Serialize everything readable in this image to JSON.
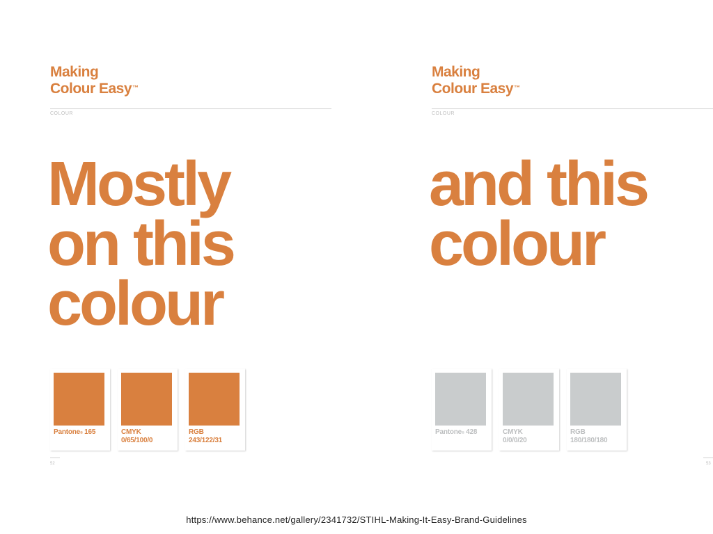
{
  "colors": {
    "orange": "#D9803F",
    "grey": "#C9CCCD",
    "grey_text": "#BDBFC0",
    "rule": "#CFCFCF"
  },
  "left_page": {
    "brand": {
      "line1": "Making",
      "line2": "Colour Easy",
      "trademark": "™"
    },
    "section_label": "COLOUR",
    "headline": [
      "Mostly",
      "on this",
      "colour"
    ],
    "swatches": [
      {
        "label": "Pantone",
        "reg": "®",
        "value": "165",
        "line2": ""
      },
      {
        "label": "CMYK",
        "reg": "",
        "value": "",
        "line2": "0/65/100/0"
      },
      {
        "label": "RGB",
        "reg": "",
        "value": "",
        "line2": "243/122/31"
      }
    ],
    "page_number": "52"
  },
  "right_page": {
    "brand": {
      "line1": "Making",
      "line2": "Colour Easy",
      "trademark": "™"
    },
    "section_label": "COLOUR",
    "headline": [
      "and this",
      "colour"
    ],
    "swatches": [
      {
        "label": "Pantone",
        "reg": "®",
        "value": "428",
        "line2": ""
      },
      {
        "label": "CMYK",
        "reg": "",
        "value": "",
        "line2": "0/0/0/20"
      },
      {
        "label": "RGB",
        "reg": "",
        "value": "",
        "line2": "180/180/180"
      }
    ],
    "page_number": "53"
  },
  "source_url": "https://www.behance.net/gallery/2341732/STIHL-Making-It-Easy-Brand-Guidelines"
}
